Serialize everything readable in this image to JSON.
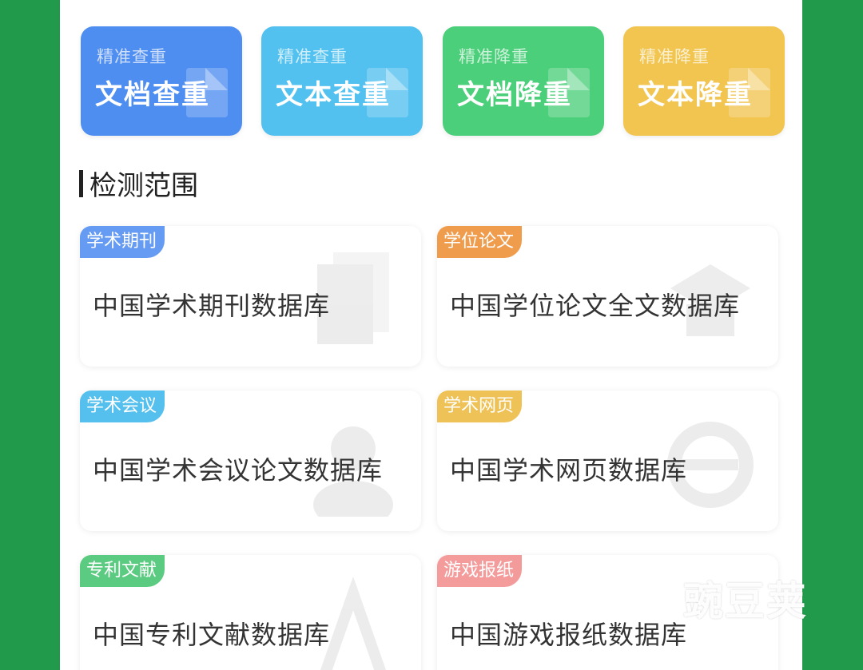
{
  "tiles": [
    {
      "sub": "精准查重",
      "main": "文档查重",
      "color": "#4f8ef1"
    },
    {
      "sub": "精准查重",
      "main": "文本查重",
      "color": "#53c1ef"
    },
    {
      "sub": "精准降重",
      "main": "文档降重",
      "color": "#4ccf7a"
    },
    {
      "sub": "精准降重",
      "main": "文本降重",
      "color": "#f1c550"
    }
  ],
  "section": {
    "title": "检测范围"
  },
  "cards": [
    {
      "tag": "学术期刊",
      "name": "中国学术期刊数据库",
      "tag_color": "#4b8af0"
    },
    {
      "tag": "学位论文",
      "name": "中国学位论文全文数据库",
      "tag_color": "#ee8b2e"
    },
    {
      "tag": "学术会议",
      "name": "中国学术会议论文数据库",
      "tag_color": "#38b6ea"
    },
    {
      "tag": "学术网页",
      "name": "中国学术网页数据库",
      "tag_color": "#ecb83a"
    },
    {
      "tag": "专利文献",
      "name": "中国专利文献数据库",
      "tag_color": "#3ec26a"
    },
    {
      "tag": "游戏报纸",
      "name": "中国游戏报纸数据库",
      "tag_color": "#f28a8a"
    }
  ],
  "watermark": {
    "text": "豌豆荚"
  }
}
